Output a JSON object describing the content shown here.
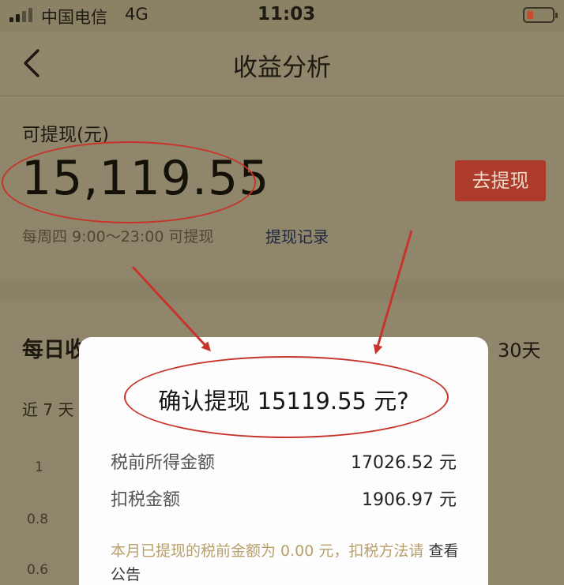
{
  "status_bar": {
    "carrier": "中国电信",
    "network": "4G",
    "time": "11:03"
  },
  "nav": {
    "title": "收益分析"
  },
  "summary": {
    "available_label": "可提现(元)",
    "amount": "15,119.55",
    "withdraw_button": "去提现",
    "schedule_text": "每周四 9:00～23:00 可提现",
    "history_link": "提现记录"
  },
  "daily": {
    "title": "每日收",
    "range_30": "30天",
    "range_7": "近 7 天",
    "y_ticks": [
      "1",
      "0.8",
      "0.6"
    ]
  },
  "modal": {
    "title": "确认提现 15119.55 元?",
    "rows": [
      {
        "label": "税前所得金额",
        "value": "17026.52 元"
      },
      {
        "label": "扣税金额",
        "value": "1906.97 元"
      }
    ],
    "note_text": "本月已提现的税前金额为 0.00 元，扣税方法请",
    "note_link": "查看公告"
  },
  "colors": {
    "overlay_background": "#8f866b",
    "accent_red": "#c8332a",
    "withdraw_button": "#ad3b2b",
    "note_text": "#b9a06a"
  },
  "icons": [
    "signal-icon",
    "battery-icon",
    "back-arrow-icon"
  ]
}
